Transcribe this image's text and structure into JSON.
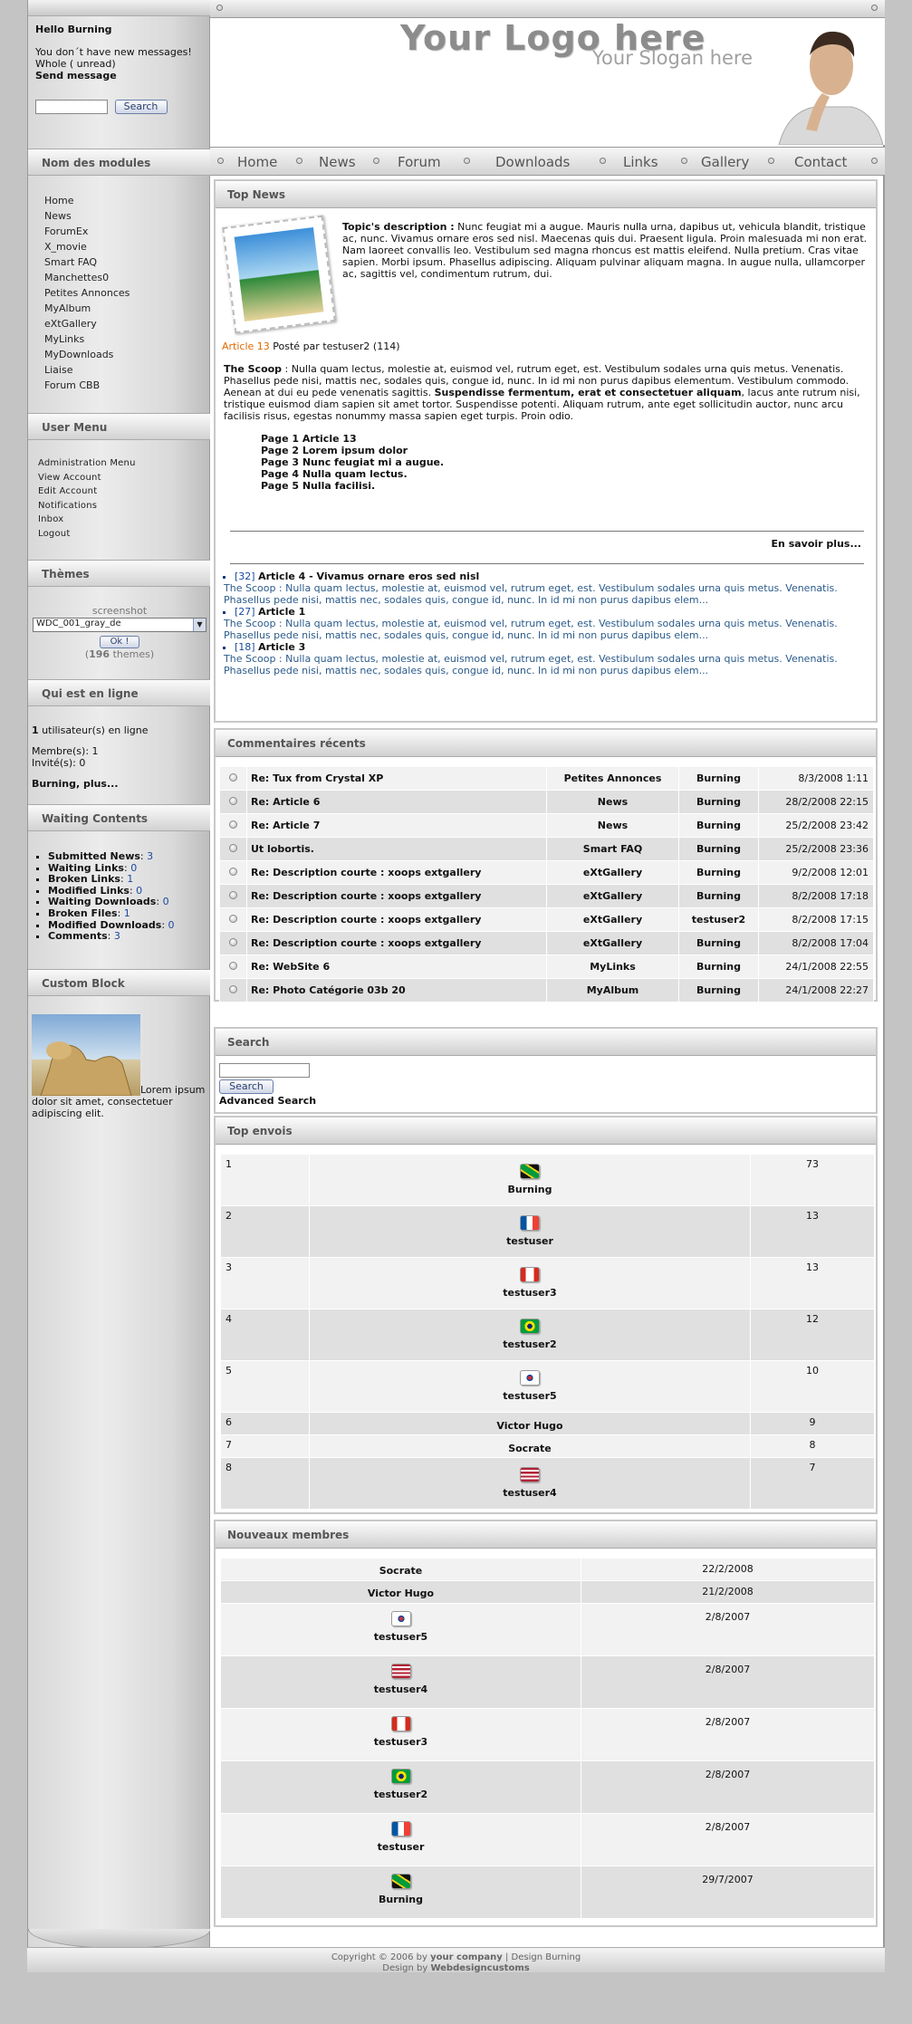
{
  "user": {
    "hello": "Hello Burning",
    "msg1": "You don´t have new messages!",
    "msg2": "Whole  ( unread)",
    "send": "Send message",
    "search_btn": "Search"
  },
  "header": {
    "logo": "Your Logo here",
    "slogan": "Your Slogan here"
  },
  "nav": [
    "Home",
    "News",
    "Forum",
    "Downloads",
    "Links",
    "Gallery",
    "Contact"
  ],
  "modules": {
    "title": "Nom des modules",
    "items": [
      "Home",
      "News",
      "ForumEx",
      "X_movie",
      "Smart FAQ",
      "Manchettes0",
      "Petites Annonces",
      "MyAlbum",
      "eXtGallery",
      "MyLinks",
      "MyDownloads",
      "Liaise",
      "Forum CBB"
    ]
  },
  "usermenu": {
    "title": "User Menu",
    "items": [
      "Administration Menu",
      "View Account",
      "Edit Account",
      "Notifications",
      "Inbox",
      "Logout"
    ]
  },
  "themes": {
    "title": "Thèmes",
    "screenshot": "screenshot",
    "selected": "WDC_001_gray_de",
    "ok": "Ok !",
    "count": "196",
    "count_suffix": " themes)"
  },
  "online": {
    "title": "Qui est en ligne",
    "count": "1",
    "count_label": " utilisateur(s) en ligne",
    "members": "Membre(s): 1",
    "guests": "Invité(s): 0",
    "who": "Burning, plus..."
  },
  "waiting": {
    "title": "Waiting Contents",
    "items": [
      {
        "label": "Submitted News",
        "value": "3"
      },
      {
        "label": "Waiting Links",
        "value": "0"
      },
      {
        "label": "Broken Links",
        "value": "1"
      },
      {
        "label": "Modified Links",
        "value": "0"
      },
      {
        "label": "Waiting Downloads",
        "value": "0"
      },
      {
        "label": "Broken Files",
        "value": "1"
      },
      {
        "label": "Modified Downloads",
        "value": "0"
      },
      {
        "label": "Comments",
        "value": "3"
      }
    ]
  },
  "custom": {
    "title": "Custom Block",
    "text": "Lorem ipsum dolor sit amet, consectetuer adipiscing elit."
  },
  "topnews": {
    "title": "Top News",
    "desc_label": "Topic's description :",
    "desc": " Nunc feugiat mi a augue. Mauris nulla urna, dapibus ut, vehicula blandit, tristique ac, nunc. Vivamus ornare eros sed nisl. Maecenas quis dui. Praesent ligula. Proin malesuada mi non erat. Nam laoreet convallis leo. Vestibulum sed magna rhoncus est mattis eleifend. Nulla pretium. Cras vitae sapien. Morbi ipsum. Phasellus adipiscing. Aliquam pulvinar aliquam magna. In augue nulla, ullamcorper ac, sagittis vel, condimentum rutrum, dui.",
    "article_link": "Article 13",
    "posted": " Posté par testuser2 (114)",
    "scoop_label": "The Scoop",
    "scoop1": " : Nulla quam lectus, molestie at, euismod vel, rutrum eget, est. Vestibulum sodales urna quis metus. Venenatis. Phasellus pede nisi, mattis nec, sodales quis, congue id, nunc. In id mi non purus dapibus elementum. Vestibulum commodo. Aenean at dui eu pede venenatis sagittis. ",
    "scoop_bold": "Suspendisse fermentum, erat et consectetuer aliquam",
    "scoop2": ", lacus ante rutrum nisi, tristique euismod diam sapien sit amet tortor. Suspendisse potenti. Aliquam rutrum, ante eget sollicitudin auctor, nunc arcu facilisis risus, egestas nonummy massa sapien eget turpis. Proin odio.",
    "pages": [
      "Page 1 Article 13",
      "Page 2 Lorem ipsum dolor",
      "Page 3 Nunc feugiat mi a augue.",
      "Page 4 Nulla quam lectus.",
      "Page 5 Nulla facilisi."
    ],
    "more": "En savoir plus...",
    "others": [
      {
        "id": "[32]",
        "title": "Article 4 - Vivamus ornare eros sed nisl",
        "text": "The Scoop : Nulla quam lectus, molestie at, euismod vel, rutrum eget, est. Vestibulum sodales urna quis metus. Venenatis. Phasellus pede nisi, mattis nec, sodales quis, congue id, nunc. In id mi non purus dapibus elem..."
      },
      {
        "id": "[27]",
        "title": "Article 1",
        "text": "The Scoop : Nulla quam lectus, molestie at, euismod vel, rutrum eget, est. Vestibulum sodales urna quis metus. Venenatis. Phasellus pede nisi, mattis nec, sodales quis, congue id, nunc. In id mi non purus dapibus elem..."
      },
      {
        "id": "[18]",
        "title": "Article 3",
        "text": "The Scoop : Nulla quam lectus, molestie at, euismod vel, rutrum eget, est. Vestibulum sodales urna quis metus. Venenatis. Phasellus pede nisi, mattis nec, sodales quis, congue id, nunc. In id mi non purus dapibus elem..."
      }
    ]
  },
  "comments": {
    "title": "Commentaires récents",
    "rows": [
      [
        "Re: Tux from Crystal XP",
        "Petites Annonces",
        "Burning",
        "8/3/2008 1:11"
      ],
      [
        "Re: Article 6",
        "News",
        "Burning",
        "28/2/2008 22:15"
      ],
      [
        "Re: Article 7",
        "News",
        "Burning",
        "25/2/2008 23:42"
      ],
      [
        "Ut lobortis.",
        "Smart FAQ",
        "Burning",
        "25/2/2008 23:36"
      ],
      [
        "Re: Description courte : xoops extgallery",
        "eXtGallery",
        "Burning",
        "9/2/2008 12:01"
      ],
      [
        "Re: Description courte : xoops extgallery",
        "eXtGallery",
        "Burning",
        "8/2/2008 17:18"
      ],
      [
        "Re: Description courte : xoops extgallery",
        "eXtGallery",
        "testuser2",
        "8/2/2008 17:15"
      ],
      [
        "Re: Description courte : xoops extgallery",
        "eXtGallery",
        "Burning",
        "8/2/2008 17:04"
      ],
      [
        "Re: WebSite 6",
        "MyLinks",
        "Burning",
        "24/1/2008 22:55"
      ],
      [
        "Re: Photo Catégorie 03b 20",
        "MyAlbum",
        "Burning",
        "24/1/2008 22:27"
      ]
    ]
  },
  "search": {
    "title": "Search",
    "button": "Search",
    "advanced": "Advanced Search"
  },
  "topposters": {
    "title": "Top envois",
    "rows": [
      {
        "rank": "1",
        "name": "Burning",
        "flag": "jm",
        "count": "73"
      },
      {
        "rank": "2",
        "name": "testuser",
        "flag": "fr",
        "count": "13"
      },
      {
        "rank": "3",
        "name": "testuser3",
        "flag": "ca",
        "count": "13"
      },
      {
        "rank": "4",
        "name": "testuser2",
        "flag": "br",
        "count": "12"
      },
      {
        "rank": "5",
        "name": "testuser5",
        "flag": "kr",
        "count": "10"
      },
      {
        "rank": "6",
        "name": "Victor Hugo",
        "flag": "",
        "count": "9"
      },
      {
        "rank": "7",
        "name": "Socrate",
        "flag": "",
        "count": "8"
      },
      {
        "rank": "8",
        "name": "testuser4",
        "flag": "us",
        "count": "7"
      }
    ]
  },
  "newmembers": {
    "title": "Nouveaux membres",
    "rows": [
      {
        "name": "Socrate",
        "flag": "",
        "date": "22/2/2008"
      },
      {
        "name": "Victor Hugo",
        "flag": "",
        "date": "21/2/2008"
      },
      {
        "name": "testuser5",
        "flag": "kr",
        "date": "2/8/2007"
      },
      {
        "name": "testuser4",
        "flag": "us",
        "date": "2/8/2007"
      },
      {
        "name": "testuser3",
        "flag": "ca",
        "date": "2/8/2007"
      },
      {
        "name": "testuser2",
        "flag": "br",
        "date": "2/8/2007"
      },
      {
        "name": "testuser",
        "flag": "fr",
        "date": "2/8/2007"
      },
      {
        "name": "Burning",
        "flag": "jm",
        "date": "29/7/2007"
      }
    ]
  },
  "footer": {
    "copy": "Copyright © 2006 by ",
    "company": "your company",
    "design": "  |  Design Burning",
    "by": "Design by ",
    "wdc": "Webdesigncustoms"
  }
}
